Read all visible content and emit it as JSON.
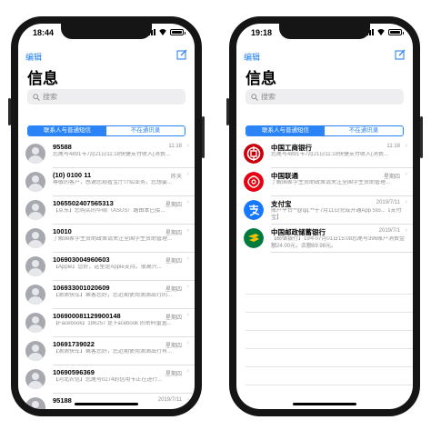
{
  "phones": [
    {
      "status_time": "18:44",
      "edit_label": "编辑",
      "title": "信息",
      "search_placeholder": "搜索",
      "segments": [
        "联系人与普通短信",
        "不在通讯录"
      ],
      "active_segment": 0,
      "threads": [
        {
          "name": "95588",
          "date": "11:18",
          "preview": "您尾号4891卡7月21日11:18快捷支付收入(消费..."
        },
        {
          "name": "(10) 0100 11",
          "date": "昨天",
          "preview": "尊敬的客户，感谢您观看宝厅介绍业务，您想要..."
        },
        {
          "name": "1065502407565313",
          "date": "星期四",
          "preview": "【京东】您购买的华硕（ASUS）路由本已接..."
        },
        {
          "name": "10010",
          "date": "星期四",
          "preview": "了解国家学生资助政策请关注全国学生资助管理..."
        },
        {
          "name": "106903004960603",
          "date": "星期四",
          "preview": "【Apple】您好，这里是Apple支持。很高兴..."
        },
        {
          "name": "106933001020609",
          "date": "星期四",
          "preview": "【滴滴快车】乘客您好，您近期使用滴滴出行的..."
        },
        {
          "name": "106900081129900148",
          "date": "星期四",
          "preview": "【Facebook】186257 是 Facebook 的密码重置..."
        },
        {
          "name": "10691739022",
          "date": "星期四",
          "preview": "【滴滴快车】乘客您好，您近期使用滴滴出行有..."
        },
        {
          "name": "10690596369",
          "date": "星期四",
          "preview": "【河北农信】您尾号0274的信用卡正在进行..."
        },
        {
          "name": "95188",
          "date": "2019/7/11",
          "preview": ""
        }
      ]
    },
    {
      "status_time": "19:18",
      "edit_label": "编辑",
      "title": "信息",
      "search_placeholder": "搜索",
      "segments": [
        "联系人与普通短信",
        "不在通讯录"
      ],
      "active_segment": 0,
      "threads": [
        {
          "name": "中国工商银行",
          "date": "11:18",
          "preview": "您尾号4891卡7月21日11:18快捷支付收入(消费...",
          "logo": "icbc-logo"
        },
        {
          "name": "中国联通",
          "date": "星期四",
          "preview": "了解国家学生资助政策请关注全国学生资助管理...",
          "logo": "unicom-logo"
        },
        {
          "name": "支付宝",
          "date": "2019/7/11",
          "preview": "账户平台**@qq.**于7月11日完成开通App Sto...【支付宝】",
          "logo": "alipay-logo"
        },
        {
          "name": "中国邮政储蓄银行",
          "date": "2019/7/1",
          "preview": "【邮储银行】19年07月01日15:08您尾号396账户消费金额24.00元，余额69.98元。",
          "logo": "psbc-logo"
        }
      ]
    }
  ],
  "colors": {
    "accent": "#1a7bf4",
    "icbc": "#c7000b",
    "unicom": "#e60012",
    "alipay": "#1677ff",
    "psbc": "#007a3d"
  }
}
